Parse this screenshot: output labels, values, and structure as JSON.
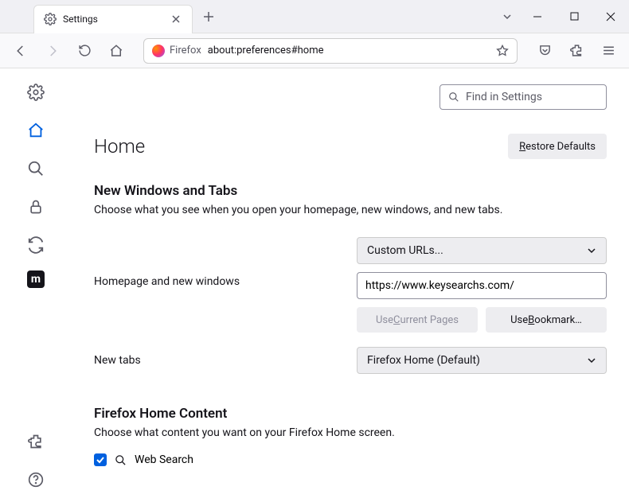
{
  "titlebar": {
    "tab_title": "Settings"
  },
  "toolbar": {
    "identity_label": "Firefox",
    "url": "about:preferences#home"
  },
  "search": {
    "placeholder": "Find in Settings"
  },
  "page": {
    "title": "Home",
    "restore_btn_prefix": "R",
    "restore_btn_rest": "estore Defaults"
  },
  "section_new_windows": {
    "title": "New Windows and Tabs",
    "desc": "Choose what you see when you open your homepage, new windows, and new tabs.",
    "homepage_label": "Homepage and new windows",
    "custom_urls_label": "Custom URLs...",
    "homepage_value": "https://www.keysearchs.com/",
    "use_current_prefix": "Use ",
    "use_current_ul": "C",
    "use_current_rest": "urrent Pages",
    "use_bookmark_prefix": "Use ",
    "use_bookmark_ul": "B",
    "use_bookmark_rest": "ookmark…",
    "newtabs_label": "New tabs",
    "newtabs_value": "Firefox Home (Default)"
  },
  "section_home_content": {
    "title": "Firefox Home Content",
    "desc": "Choose what content you want on your Firefox Home screen.",
    "web_search_label": "Web Search"
  },
  "sidebar": {
    "m_label": "m"
  }
}
